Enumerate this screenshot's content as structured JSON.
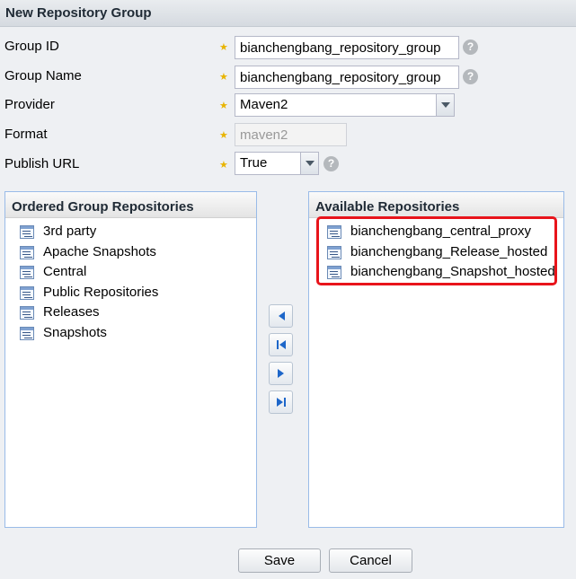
{
  "window": {
    "title": "New Repository Group"
  },
  "form": {
    "group_id": {
      "label": "Group ID",
      "value": "bianchengbang_repository_group",
      "help": "?"
    },
    "group_name": {
      "label": "Group Name",
      "value": "bianchengbang_repository_group",
      "help": "?"
    },
    "provider": {
      "label": "Provider",
      "value": "Maven2"
    },
    "format": {
      "label": "Format",
      "value": "maven2"
    },
    "publish_url": {
      "label": "Publish URL",
      "value": "True",
      "help": "?"
    },
    "required_mark": "★"
  },
  "ordered_panel": {
    "title": "Ordered Group Repositories",
    "items": [
      "3rd party",
      "Apache Snapshots",
      "Central",
      "Public Repositories",
      "Releases",
      "Snapshots"
    ]
  },
  "available_panel": {
    "title": "Available Repositories",
    "items": [
      "bianchengbang_central_proxy",
      "bianchengbang_Release_hosted",
      "bianchengbang_Snapshot_hosted"
    ]
  },
  "move_buttons": [
    "move-left-icon",
    "move-all-left-icon",
    "move-right-icon",
    "move-all-right-icon"
  ],
  "actions": {
    "save_label": "Save",
    "cancel_label": "Cancel"
  },
  "colors": {
    "highlight": "#e8141b",
    "required_star": "#e8b400",
    "move_arrow": "#1d66c9"
  }
}
